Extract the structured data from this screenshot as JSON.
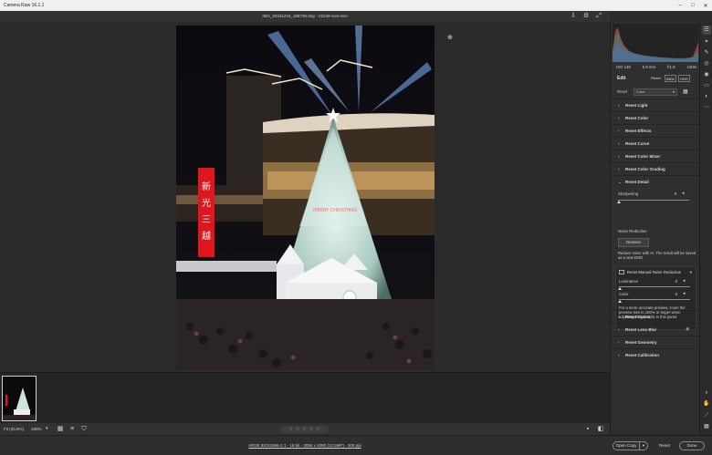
{
  "window": {
    "title": "Camera Raw 16.1.1"
  },
  "file": {
    "name": "IMG_20231216_185739.dng - V2246-vivo-vivo"
  },
  "bottom_bar": {
    "fit_label": "Fit (25.8%)",
    "zoom_label": "100%"
  },
  "status": {
    "info": "sRGB IEC61966-2.1 - 16 bit - 3056 x 4080 (12.5MP) - 300 ppi"
  },
  "camera": {
    "iso": "ISO 148",
    "focal": "5.8 mm",
    "aperture": "f/1.8",
    "shutter": "1/60s"
  },
  "edit": {
    "label": "Edit",
    "reset_label": "Reset",
    "bw_label": "B&W",
    "hdr_label": "HDR"
  },
  "profile": {
    "reset_label": "Reset",
    "value": "Color"
  },
  "sections_top": [
    {
      "title": "Reset Light"
    },
    {
      "title": "Reset Color"
    },
    {
      "title": "Reset Effects"
    },
    {
      "title": "Reset Curve"
    },
    {
      "title": "Reset Color Mixer"
    },
    {
      "title": "Reset Color Grading"
    },
    {
      "title": "Reset Detail"
    }
  ],
  "detail": {
    "sharpening_label": "Sharpening",
    "sharpening_value": "0",
    "noise_reduction_label": "Noise Reduction",
    "denoise_label": "Denoise",
    "denoise_note": "Reduce noise with AI. The result will be saved as a new DNG.",
    "manual_title": "Reset Manual Noise Reduction",
    "luminance_label": "Luminance",
    "luminance_value": "0",
    "color_label": "Color",
    "color_value": "0",
    "manual_note": "For a more accurate preview, zoom the preview size to 100% or larger when adjusting the controls in this panel."
  },
  "sections_bottom": [
    {
      "title": "Reset Optics"
    },
    {
      "title": "Reset Lens Blur"
    },
    {
      "title": "Reset Geometry"
    },
    {
      "title": "Reset Calibration"
    }
  ],
  "rating": {
    "stars": [
      "☆",
      "☆",
      "☆",
      "☆",
      "☆"
    ]
  },
  "actions": {
    "open_label": "Open Copy",
    "reset_label": "Reset",
    "done_label": "Done"
  },
  "photo": {
    "sign_text": [
      "新",
      "光",
      "三",
      "越"
    ],
    "tree_text": "MERRY CHRISTMAS"
  },
  "colors": {
    "panel": "#2f2f2f",
    "canvas": "#2b2b2b",
    "sign_red": "#e0161e"
  }
}
